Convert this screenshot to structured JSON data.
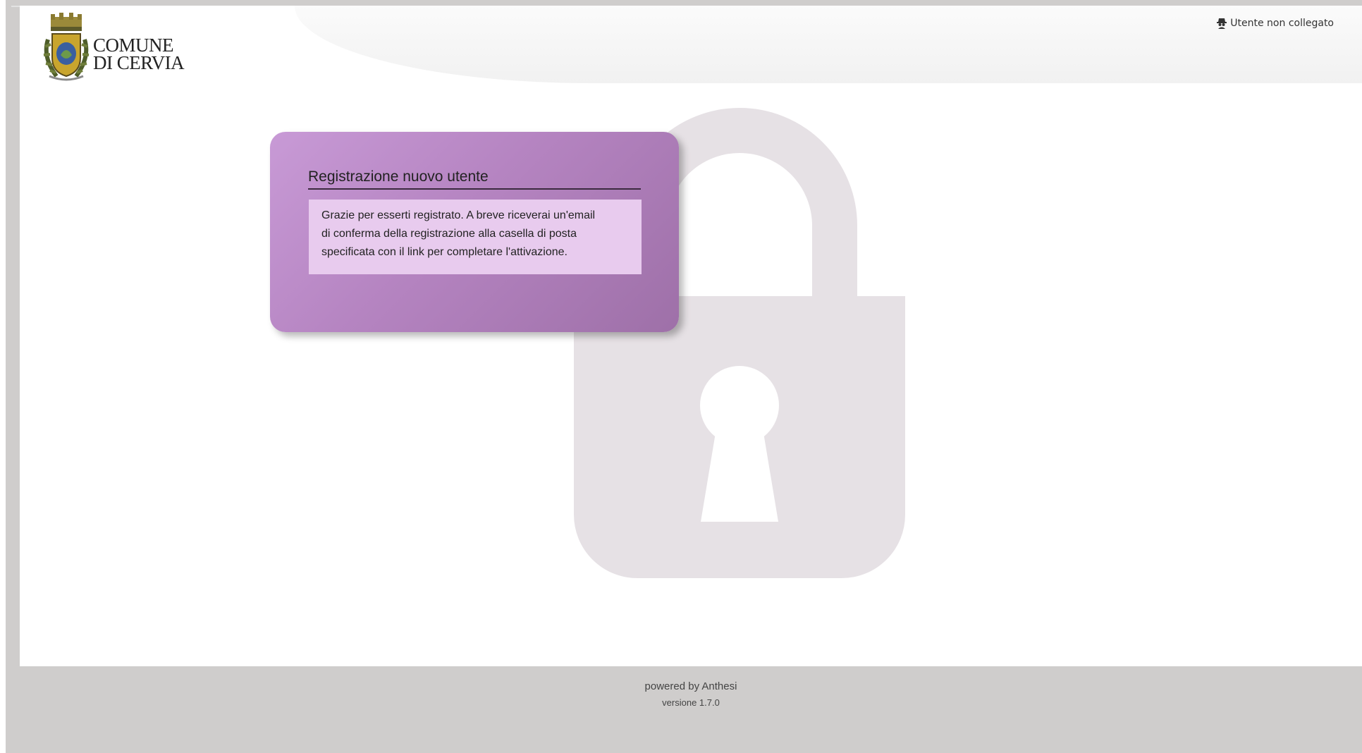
{
  "header": {
    "logo_line1": "COMUNE",
    "logo_line2": "DI CERVIA",
    "user_status": "Utente non collegato",
    "user_icon": "user-incognito-icon"
  },
  "background": {
    "lock_icon": "padlock-icon",
    "lock_color": "#e6e1e5"
  },
  "card": {
    "title": "Registrazione nuovo utente",
    "message_line1": "Grazie per esserti registrato. A breve riceverai un'email",
    "message_line2": "di conferma della registrazione alla casella di posta",
    "message_line3": "specificata con il link per completare l'attivazione.",
    "color_start": "#c89ad6",
    "color_end": "#9e70a8",
    "message_bg": "#e8cbee"
  },
  "footer": {
    "powered": "powered by Anthesi",
    "version": "versione 1.7.0"
  }
}
